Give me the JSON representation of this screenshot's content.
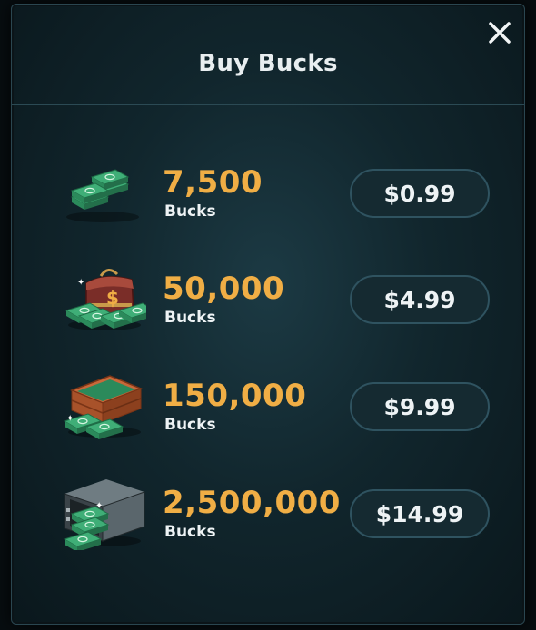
{
  "dialog": {
    "title": "Buy Bucks",
    "close_icon": "close-icon"
  },
  "packages": [
    {
      "amount": "7,500",
      "unit": "Bucks",
      "price": "$0.99",
      "icon": "cash-stacks-icon"
    },
    {
      "amount": "50,000",
      "unit": "Bucks",
      "price": "$4.99",
      "icon": "money-bag-icon"
    },
    {
      "amount": "150,000",
      "unit": "Bucks",
      "price": "$9.99",
      "icon": "cash-crate-icon"
    },
    {
      "amount": "2,500,000",
      "unit": "Bucks",
      "price": "$14.99",
      "icon": "money-safe-icon"
    }
  ],
  "colors": {
    "amount": "#f0ae45",
    "button_border": "#2f5360",
    "panel": "#11262d"
  }
}
